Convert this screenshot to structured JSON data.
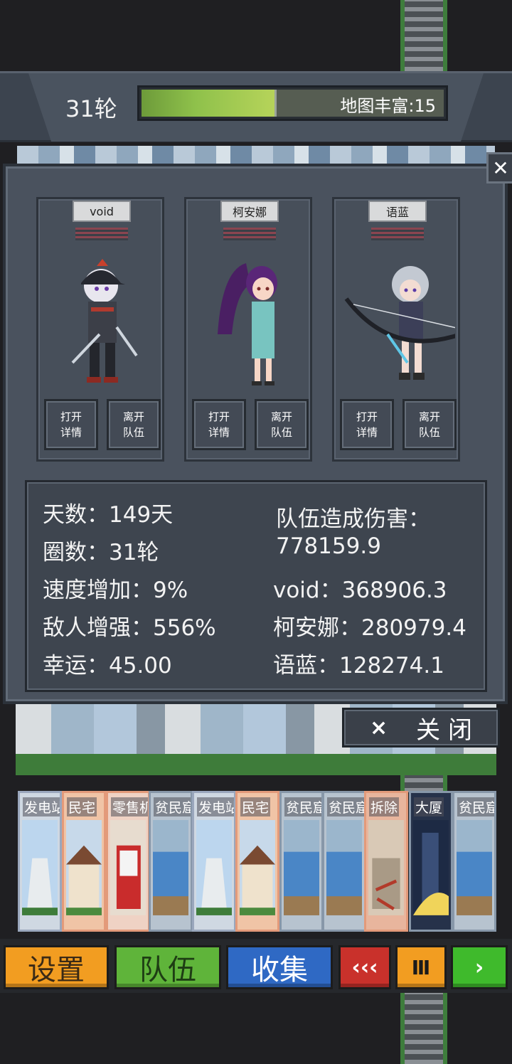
{
  "header": {
    "round": "31轮",
    "map_richness": "地图丰富:15"
  },
  "team": {
    "members": [
      {
        "name": "void",
        "details_label": "打开\n详情",
        "leave_label": "离开\n队伍"
      },
      {
        "name": "柯安娜",
        "details_label": "打开\n详情",
        "leave_label": "离开\n队伍"
      },
      {
        "name": "语蓝",
        "details_label": "打开\n详情",
        "leave_label": "离开\n队伍"
      }
    ],
    "close_x_icon": "close-icon"
  },
  "stats": {
    "days": "天数：149天",
    "laps": "圈数：31轮",
    "speed": "速度增加：9%",
    "enemy": "敌人增强：556%",
    "luck": "幸运：45.00",
    "damage_title": "队伍造成伤害：",
    "damage_total": "778159.9",
    "damage_void": "void：368906.3",
    "damage_keanna": "柯安娜：280979.4",
    "damage_yulan": "语蓝：128274.1"
  },
  "close_button": {
    "icon": "×",
    "label": "关  闭"
  },
  "hand": {
    "cards": [
      {
        "title": "发电站",
        "kind": "power"
      },
      {
        "title": "民宅",
        "kind": "house"
      },
      {
        "title": "零售机",
        "kind": "vend"
      },
      {
        "title": "贫民窟",
        "kind": "poor"
      },
      {
        "title": "发电站",
        "kind": "power"
      },
      {
        "title": "民宅",
        "kind": "house"
      },
      {
        "title": "贫民窟",
        "kind": "poor"
      },
      {
        "title": "贫民窟",
        "kind": "poor"
      },
      {
        "title": "拆除",
        "kind": "demo"
      },
      {
        "title": "大厦",
        "kind": "tower"
      },
      {
        "title": "贫民窟",
        "kind": "poor"
      }
    ]
  },
  "bottom_bar": {
    "settings": "设置",
    "team": "队伍",
    "collect": "收集",
    "rewind": "‹‹‹",
    "pause": "Ⅲ",
    "play": "›"
  }
}
